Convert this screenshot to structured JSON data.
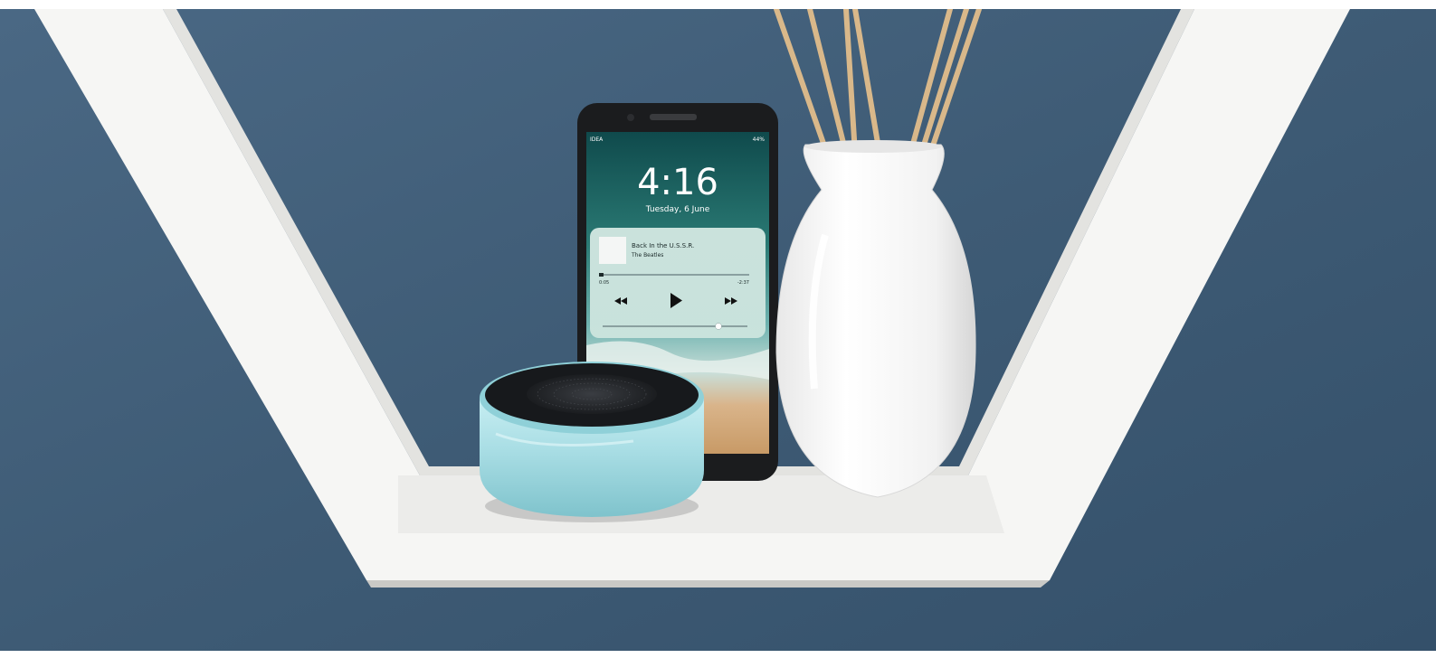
{
  "phone": {
    "carrier": "IDEA",
    "battery_pct": "44%",
    "time": "4:16",
    "date": "Tuesday, 6 June",
    "now_playing": {
      "song": "Back In the U.S.S.R.",
      "artist": "The Beatles",
      "elapsed": "0:05",
      "remaining": "-2:37",
      "progress": 0.03,
      "volume": 0.8
    }
  },
  "colors": {
    "wall": "#3f5c76",
    "shelf": "#f4f4f2",
    "speaker_body": "#a8dde4",
    "speaker_top": "#1a1c1f",
    "vase": "#fafafa",
    "reed": "#d9b88a"
  }
}
